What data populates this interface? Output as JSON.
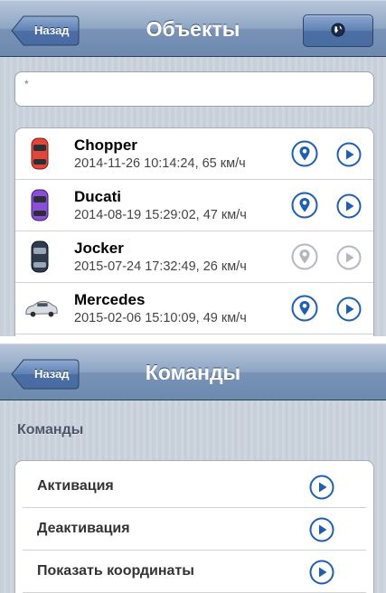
{
  "objects_screen": {
    "back_label": "Назад",
    "title": "Объекты",
    "globe_icon": "globe-icon",
    "search_value": "*",
    "items": [
      {
        "name": "Chopper",
        "meta": "2014-11-26 10:14:24, 65 км/ч",
        "car_color": "#e0473a",
        "active": true
      },
      {
        "name": "Ducati",
        "meta": "2014-08-19 15:29:02, 47 км/ч",
        "car_color": "#8a4fd6",
        "active": true
      },
      {
        "name": "Jocker",
        "meta": "2015-07-24 17:32:49, 26 км/ч",
        "car_color": "#2e3b4d",
        "active": false
      },
      {
        "name": "Mercedes",
        "meta": "2015-02-06 15:10:09, 49 км/ч",
        "car_color": "#d9dde3",
        "active": true
      }
    ]
  },
  "commands_screen": {
    "back_label": "Назад",
    "title": "Команды",
    "section_header": "Команды",
    "commands": [
      {
        "label": "Активация"
      },
      {
        "label": "Деактивация"
      },
      {
        "label": "Показать координаты"
      }
    ]
  },
  "colors": {
    "accent_blue": "#1f5fb0",
    "disabled_gray": "#b4b8bd",
    "navbar_blue": "#7893b6"
  }
}
